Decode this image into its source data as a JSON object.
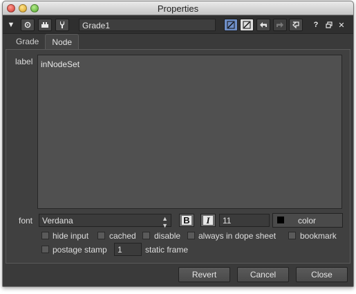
{
  "window": {
    "title": "Properties"
  },
  "toolbar": {
    "collapse_icon": "triangle-down-icon",
    "center_icon": "target-icon",
    "viewer_icon": "node-icon",
    "settings_icon": "wrench-icon",
    "node_name": "Grade1",
    "help_label": "?",
    "float_icon": "float-window-icon",
    "close_label": "✕"
  },
  "tabs": [
    {
      "label": "Grade",
      "active": false
    },
    {
      "label": "Node",
      "active": true
    }
  ],
  "node_panel": {
    "label_caption": "label",
    "label_value": "inNodeSet",
    "font_caption": "font",
    "font_value": "Verdana",
    "bold_label": "B",
    "italic_label": "I",
    "font_size": "11",
    "color_label": "color",
    "checkboxes": [
      {
        "label": "hide input",
        "checked": false
      },
      {
        "label": "cached",
        "checked": false
      },
      {
        "label": "disable",
        "checked": false
      },
      {
        "label": "always in dope sheet",
        "checked": false
      },
      {
        "label": "bookmark",
        "checked": false
      },
      {
        "label": "postage stamp",
        "checked": false
      }
    ],
    "static_frame_value": "1",
    "static_frame_label": "static frame"
  },
  "buttons": {
    "revert": "Revert",
    "cancel": "Cancel",
    "close": "Close"
  },
  "colors": {
    "panel_bg": "#404040",
    "accent_blue": "#6f8fc8"
  }
}
